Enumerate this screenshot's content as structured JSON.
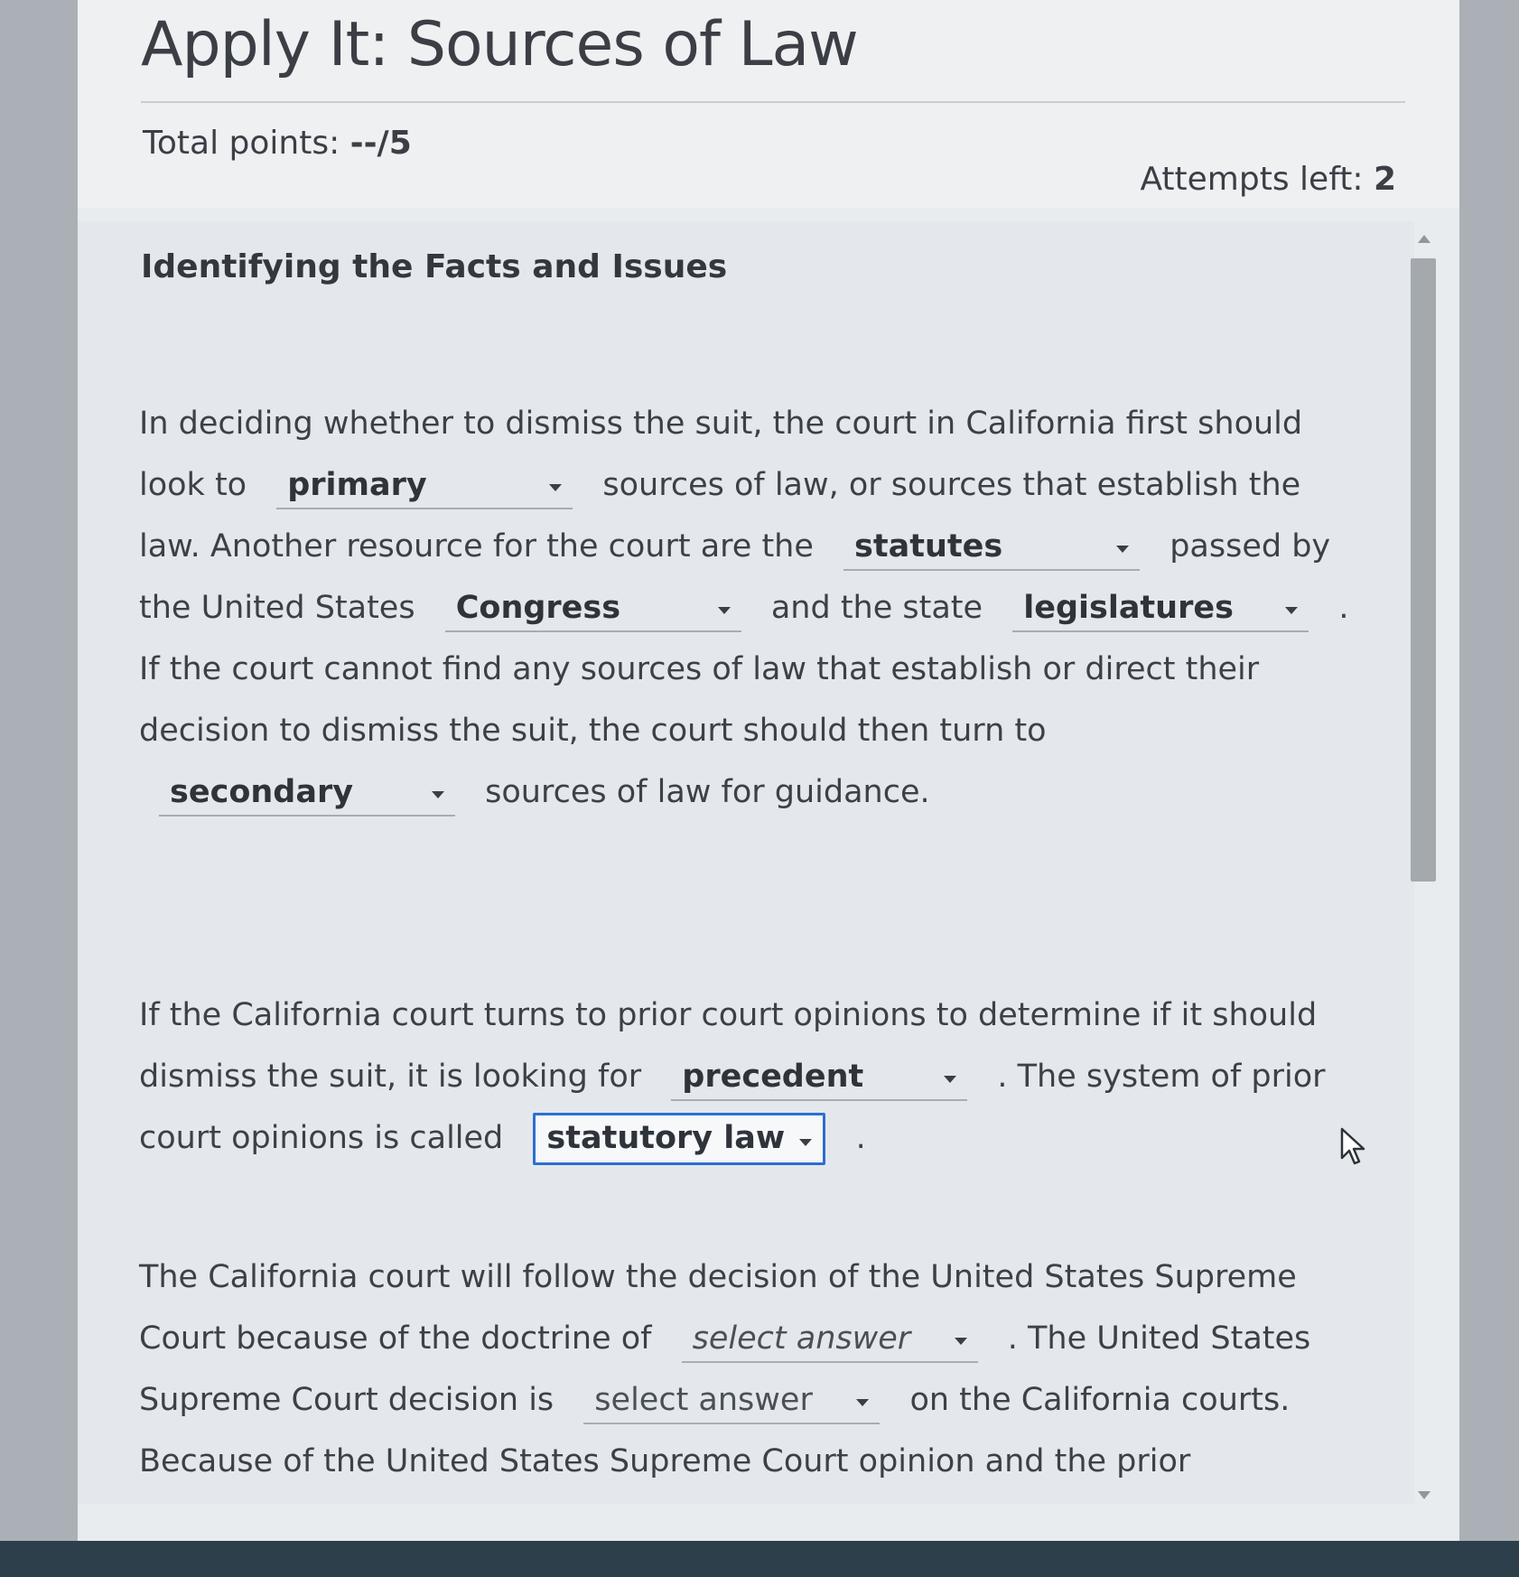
{
  "header": {
    "title": "Apply It: Sources of Law",
    "total_points_label": "Total points:",
    "total_points_value": "--/5",
    "attempts_label": "Attempts left:",
    "attempts_value": "2"
  },
  "section": {
    "title": "Identifying the Facts and Issues"
  },
  "paragraph1": {
    "t1": "In deciding whether to dismiss the suit, the court in California first should look to",
    "dd1": "primary",
    "t2": "sources of law, or sources that establish the law. Another resource for the court are the",
    "dd2": "statutes",
    "t3": "passed by the United States",
    "dd3": "Congress",
    "t4": "and the state",
    "dd4": "legislatures",
    "t5": ". If the court cannot find any sources of law that establish or direct their decision to dismiss the suit, the court should then turn to",
    "dd5": "secondary",
    "t6": "sources of law for guidance."
  },
  "paragraph2": {
    "t1": "If the California court turns to prior court opinions to determine if it should dismiss the suit, it is looking for",
    "dd1": "precedent",
    "t2": ". The system of prior court opinions is called",
    "dd2": "statutory law",
    "t3": "."
  },
  "paragraph3": {
    "t1": "The California court will follow the decision of the United States Supreme Court because of the doctrine of",
    "dd1": "select answer",
    "t2": ". The United States Supreme Court decision is",
    "dd2": "select answer",
    "t3": "on the California courts. Because of the United States Supreme Court opinion and the prior California cases regarding"
  }
}
